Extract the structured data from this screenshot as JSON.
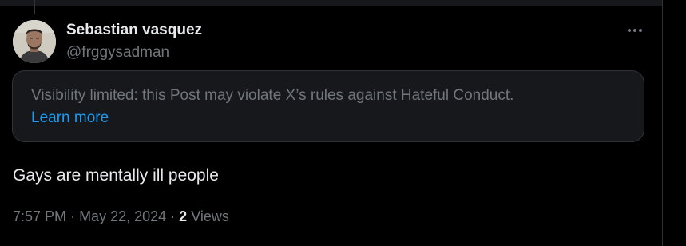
{
  "author": {
    "name": "Sebastian vasquez",
    "handle": "@frggysadman",
    "avatar_icon": "user-photo-avatar"
  },
  "more_icon": "more-horizontal-icon",
  "notice": {
    "text": "Visibility limited: this Post may violate X’s rules against Hateful Conduct.",
    "link_label": "Learn more"
  },
  "post": {
    "text": "Gays are mentally ill people"
  },
  "meta": {
    "time": "7:57 PM",
    "separator": "·",
    "date": "May 22, 2024",
    "views_count": "2",
    "views_label": "Views"
  },
  "colors": {
    "background": "#000000",
    "primary_text": "#e7e9ea",
    "secondary_text": "#71767b",
    "link": "#1d9bf0",
    "notice_background": "#16181c",
    "border": "#2f3336"
  }
}
